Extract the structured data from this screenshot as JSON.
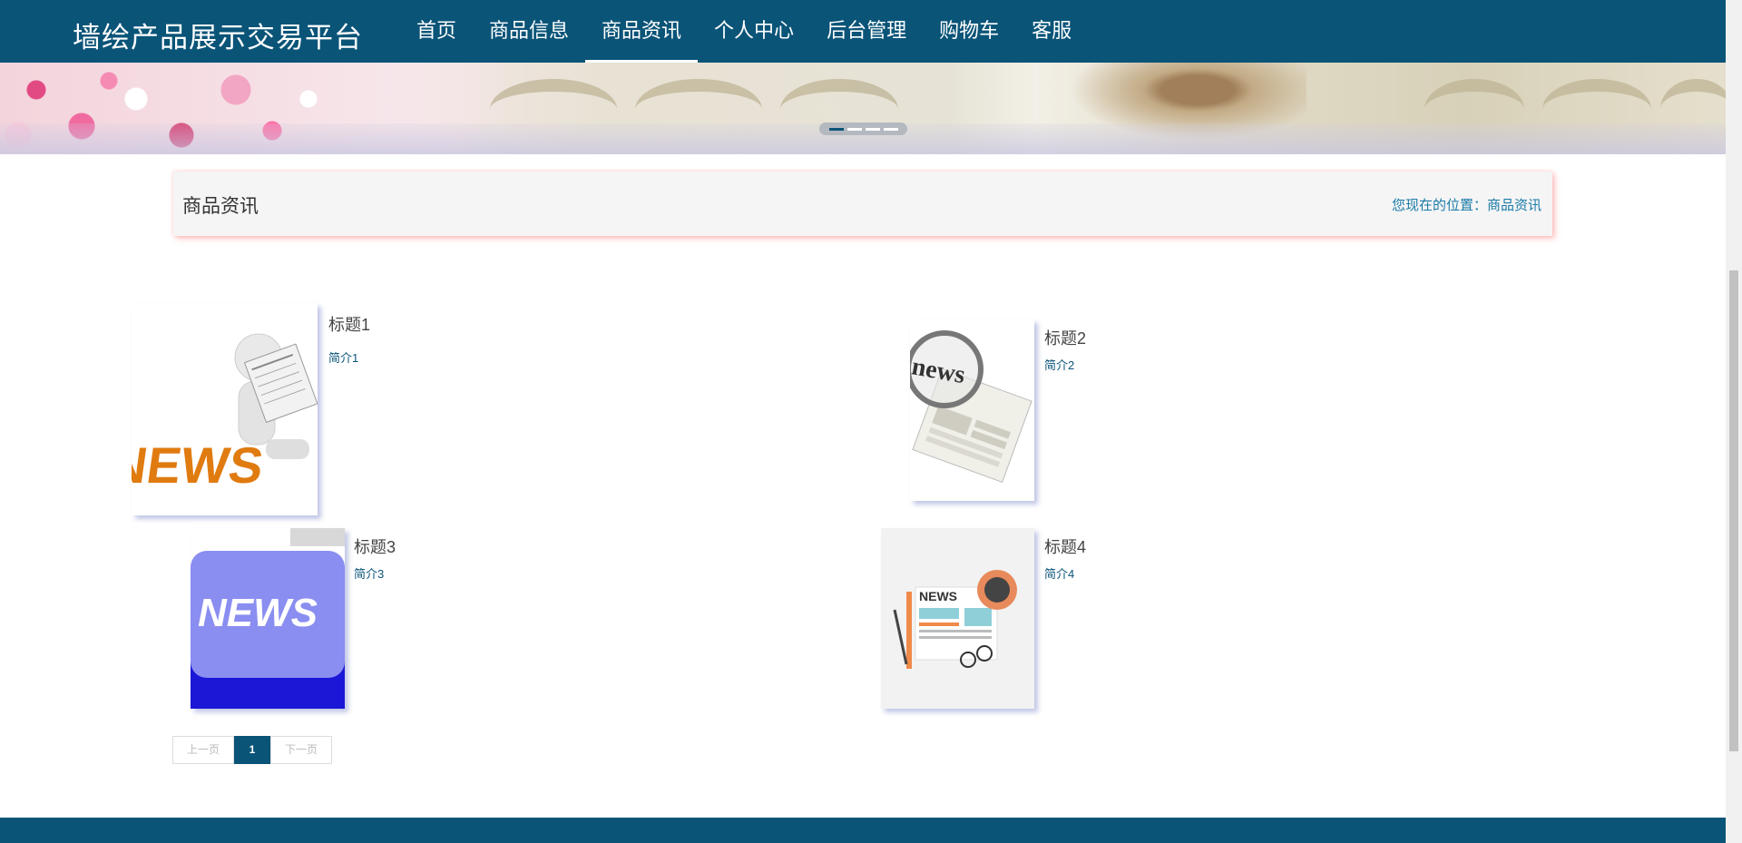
{
  "header": {
    "brand": "墙绘产品展示交易平台",
    "nav": [
      "首页",
      "商品信息",
      "商品资讯",
      "个人中心",
      "后台管理",
      "购物车",
      "客服"
    ],
    "active_index": 2
  },
  "banner": {
    "slide_count": 4,
    "active_slide": 1
  },
  "section": {
    "title": "商品资讯",
    "location": "您现在的位置：商品资讯"
  },
  "articles": [
    {
      "title": "标题1",
      "intro": "简介1",
      "image": "news-figure-reading-newspaper"
    },
    {
      "title": "标题2",
      "intro": "简介2",
      "image": "news-magnifier-newspaper"
    },
    {
      "title": "标题3",
      "intro": "简介3",
      "image": "news-keyboard-key"
    },
    {
      "title": "标题4",
      "intro": "简介4",
      "image": "news-flat-illustration"
    }
  ],
  "pagination": {
    "prev": "上一页",
    "current": "1",
    "next": "下一页"
  },
  "colors": {
    "primary": "#0a5478",
    "link": "#1a7aa8"
  }
}
